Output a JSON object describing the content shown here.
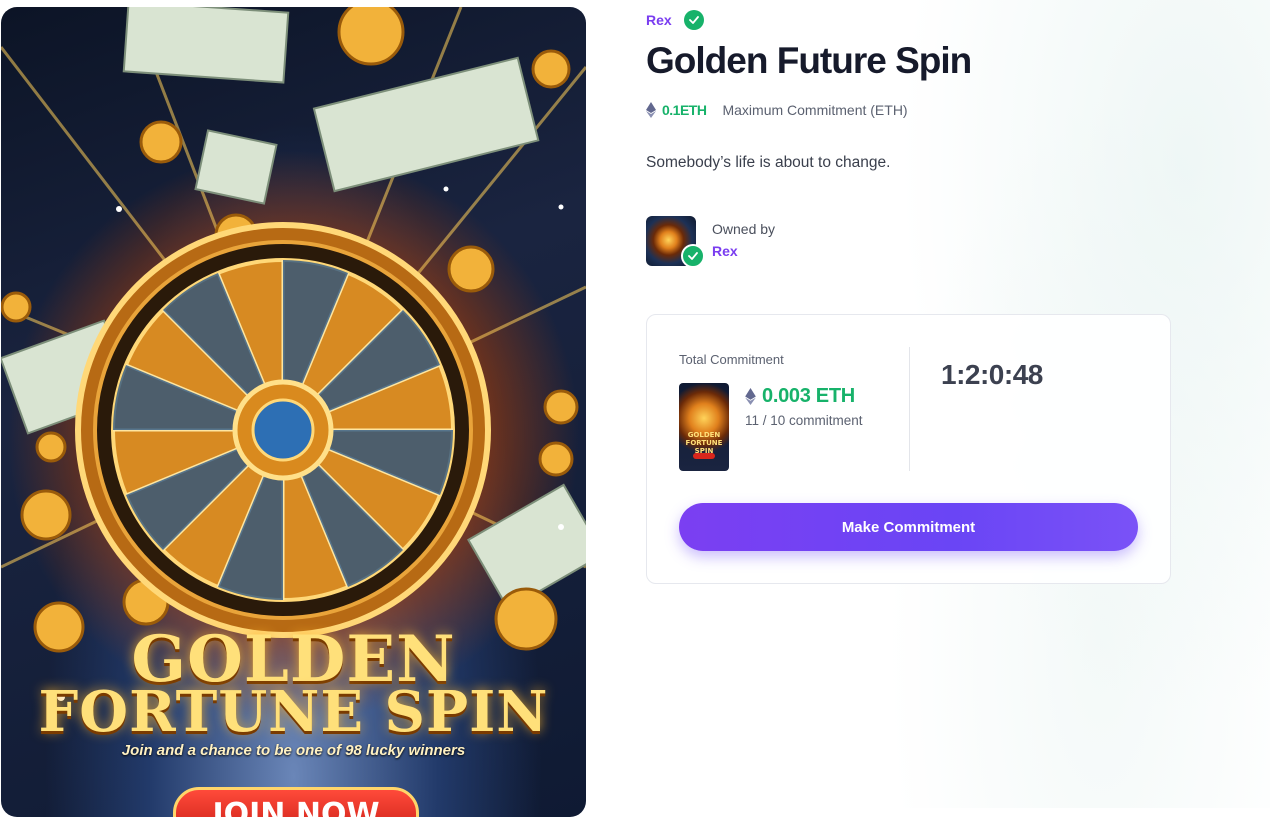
{
  "artwork": {
    "line1": "GOLDEN",
    "line2": "FORTUNE SPIN",
    "tagline": "Join and a chance to be one of 98 lucky winners",
    "cta": "JOIN NOW",
    "wheel_symbol": "$"
  },
  "creator": {
    "name": "Rex",
    "verified_icon": "check-circle-icon"
  },
  "title": "Golden Future Spin",
  "max_commitment": {
    "value": "0.1ETH",
    "label": "Maximum Commitment (ETH)",
    "icon": "ethereum-icon"
  },
  "description": "Somebody’s life is about to change.",
  "owner": {
    "label": "Owned by",
    "name": "Rex"
  },
  "commitment": {
    "label": "Total Commitment",
    "amount": "0.003 ETH",
    "count": "11 / 10 commitment",
    "countdown": "1:2:0:48",
    "button_label": "Make Commitment"
  },
  "colors": {
    "accent_purple": "#6a45f5",
    "eth_green": "#17b26a",
    "link_purple": "#7a3df0"
  }
}
